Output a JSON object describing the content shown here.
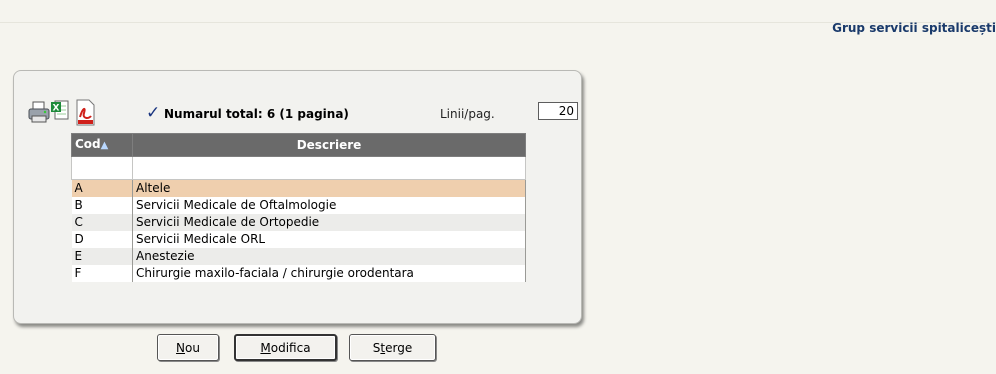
{
  "header": {
    "title": "Grup servicii spitalicești"
  },
  "toolbar": {
    "total_label": "Numarul total: 6 (1 pagina)",
    "lines_label": "Linii/pag.",
    "lines_value": "20",
    "icons": [
      "printer-icon",
      "excel-icon",
      "pdf-icon",
      "checkmark-icon"
    ]
  },
  "table": {
    "columns": [
      {
        "label": "Cod"
      },
      {
        "label": "Descriere"
      }
    ],
    "rows": [
      {
        "code": "A",
        "desc": "Altele"
      },
      {
        "code": "B",
        "desc": "Servicii Medicale de Oftalmologie"
      },
      {
        "code": "C",
        "desc": "Servicii Medicale de Ortopedie"
      },
      {
        "code": "D",
        "desc": "Servicii Medicale ORL"
      },
      {
        "code": "E",
        "desc": "Anestezie"
      },
      {
        "code": "F",
        "desc": "Chirurgie maxilo-faciala / chirurgie orodentara"
      }
    ]
  },
  "buttons": {
    "new_key": "N",
    "new_rest": "ou",
    "edit_key": "M",
    "edit_rest": "odifica",
    "delete_first": "S",
    "delete_key": "t",
    "delete_rest": "erge"
  }
}
